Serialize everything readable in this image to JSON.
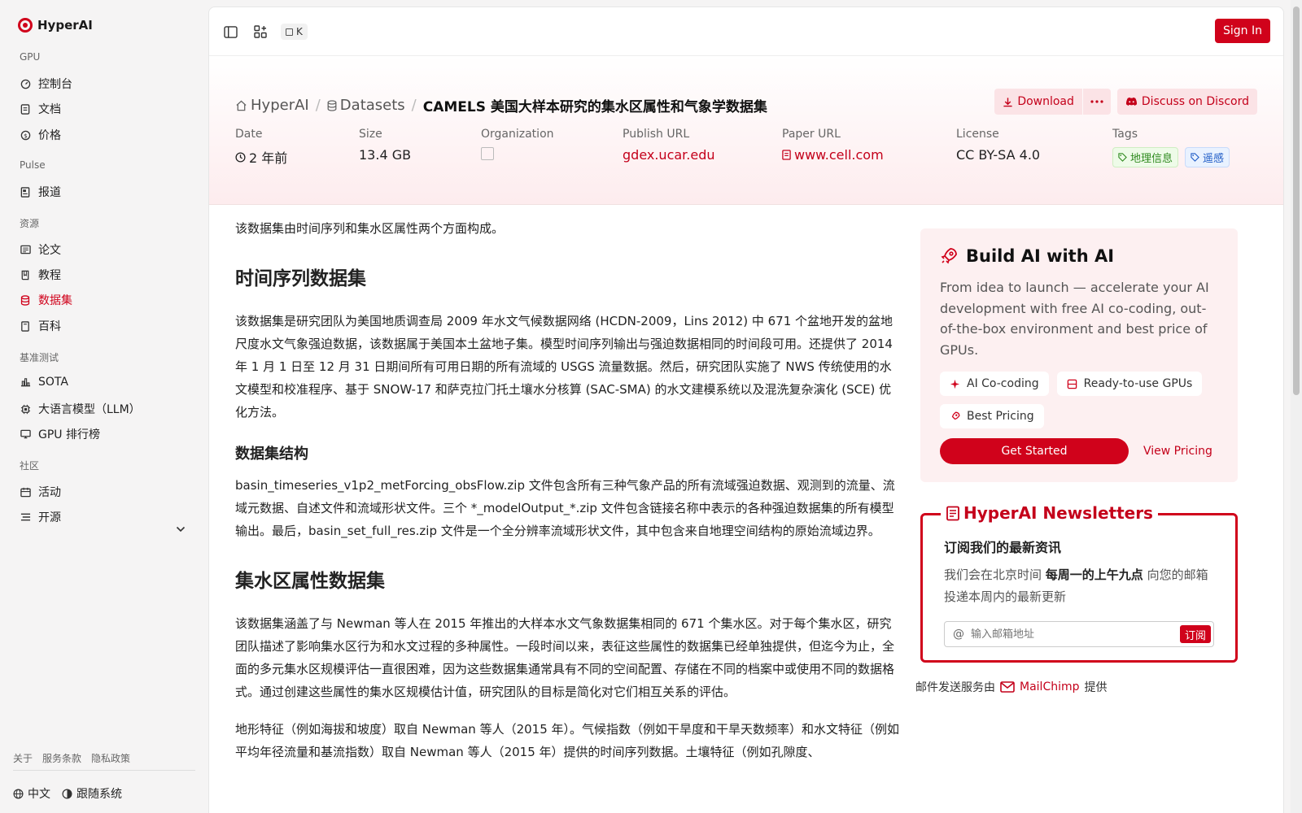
{
  "app": {
    "name": "HyperAI"
  },
  "sidebar": {
    "sections": [
      {
        "title": "GPU",
        "items": [
          "控制台",
          "文档",
          "价格"
        ]
      },
      {
        "title": "Pulse",
        "items": [
          "报道"
        ]
      },
      {
        "title": "资源",
        "items": [
          "论文",
          "教程",
          "数据集",
          "百科"
        ]
      },
      {
        "title": "基准测试",
        "items": [
          "SOTA",
          "大语言模型（LLM）",
          "GPU 排行榜"
        ]
      },
      {
        "title": "社区",
        "items": [
          "活动",
          "开源"
        ]
      }
    ],
    "active_item": "数据集",
    "footer_links": [
      "关于",
      "服务条款",
      "隐私政策"
    ],
    "language": "中文",
    "theme": "跟随系统"
  },
  "topbar": {
    "shortcut_key": "K",
    "sign_in": "Sign In"
  },
  "breadcrumb": {
    "home": "HyperAI",
    "section": "Datasets",
    "current": "CAMELS 美国大样本研究的集水区属性和气象学数据集"
  },
  "actions": {
    "download": "Download",
    "discord": "Discuss on Discord"
  },
  "meta": {
    "date_label": "Date",
    "date_value": "2 年前",
    "size_label": "Size",
    "size_value": "13.4 GB",
    "org_label": "Organization",
    "publish_label": "Publish URL",
    "publish_value": "gdex.ucar.edu",
    "paper_label": "Paper URL",
    "paper_value": "www.cell.com",
    "license_label": "License",
    "license_value": "CC BY-SA 4.0",
    "tags_label": "Tags",
    "tag1": "地理信息",
    "tag2": "遥感"
  },
  "article": {
    "intro": "该数据集由时间序列和集水区属性两个方面构成。",
    "h_timeseries": "时间序列数据集",
    "p_timeseries": "该数据集是研究团队为美国地质调查局 2009 年水文气候数据网络 (HCDN-2009，Lins 2012) 中 671 个盆地开发的盆地尺度水文气象强迫数据，该数据属于美国本土盆地子集。模型时间序列输出与强迫数据相同的时间段可用。还提供了 2014 年 1 月 1 日至 12 月 31 日期间所有可用日期的所有流域的 USGS 流量数据。然后，研究团队实施了 NWS 传统使用的水文模型和校准程序、基于 SNOW-17 和萨克拉门托土壤水分核算 (SAC-SMA) 的水文建模系统以及混洗复杂演化 (SCE) 优化方法。",
    "h_structure": "数据集结构",
    "p_structure": "basin_timeseries_v1p2_metForcing_obsFlow.zip 文件包含所有三种气象产品的所有流域强迫数据、观测到的流量、流域元数据、自述文件和流域形状文件。三个 *_modelOutput_*.zip 文件包含链接名称中表示的各种强迫数据集的所有模型输出。最后，basin_set_full_res.zip 文件是一个全分辨率流域形状文件，其中包含来自地理空间结构的原始流域边界。",
    "h_attributes": "集水区属性数据集",
    "p_attributes": "该数据集涵盖了与 Newman 等人在 2015 年推出的大样本水文气象数据集相同的 671 个集水区。对于每个集水区，研究团队描述了影响集水区行为和水文过程的多种属性。一段时间以来，表征这些属性的数据集已经单独提供，但迄今为止，全面的多元集水区规模评估一直很困难，因为这些数据集通常具有不同的空间配置、存储在不同的档案中或使用不同的数据格式。通过创建这些属性的集水区规模估计值，研究团队的目标是简化对它们相互关系的评估。",
    "p_terrain": "地形特征（例如海拔和坡度）取自 Newman 等人（2015 年）。气候指数（例如干旱度和干旱天数频率）和水文特征（例如平均年径流量和基流指数）取自 Newman 等人（2015 年）提供的时间序列数据。土壤特征（例如孔隙度、"
  },
  "promo": {
    "title": "Build AI with AI",
    "description": "From idea to launch — accelerate your AI development with free AI co-coding, out-of-the-box environment and best price of GPUs.",
    "chip1": "AI Co-coding",
    "chip2": "Ready-to-use GPUs",
    "chip3": "Best Pricing",
    "cta": "Get Started",
    "secondary": "View Pricing"
  },
  "newsletter": {
    "legend": "HyperAI Newsletters",
    "title": "订阅我们的最新资讯",
    "desc_before": "我们会在北京时间 ",
    "desc_bold": "每周一的上午九点",
    "desc_after": " 向您的邮箱投递本周内的最新更新",
    "placeholder": "输入邮箱地址",
    "subscribe": "订阅",
    "provider_before": "邮件发送服务由",
    "provider_name": "MailChimp",
    "provider_after": "提供"
  },
  "colors": {
    "brand": "#d0021b"
  },
  "icons": {
    "sidebar": [
      "gauge-icon",
      "doc-icon",
      "dollar-icon",
      "news-icon",
      "paper-icon",
      "book-icon",
      "database-icon",
      "book-open-icon",
      "chart-icon",
      "chip-icon",
      "monitor-icon",
      "calendar-icon",
      "list-icon"
    ]
  }
}
